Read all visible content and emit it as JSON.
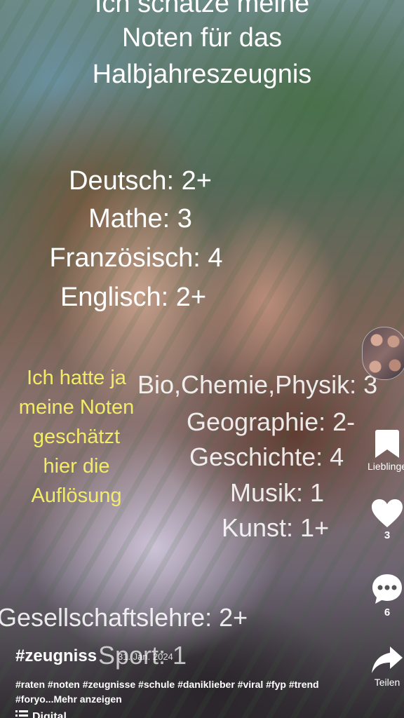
{
  "video": {
    "title_lines": [
      "Ich schätze meine",
      "Noten für das",
      "Halbjahreszeugnis"
    ],
    "grades_top": [
      "Deutsch: 2+",
      "Mathe: 3",
      "Französisch: 4",
      "Englisch: 2+"
    ],
    "grades_right": [
      "Bio,Chemie,Physik: 3",
      "Geographie: 2-",
      "Geschichte: 4",
      "Musik: 1",
      "Kunst: 1+"
    ],
    "grades_bottom": [
      "Gesellschaftslehre: 2+",
      "Sport: 1"
    ],
    "note_lines": [
      "Ich hatte ja",
      "meine Noten",
      "geschätzt",
      "hier die",
      "Auflösung"
    ],
    "note_color": "#f3ec6a"
  },
  "rail": {
    "favorite_label": "Lieblinge",
    "likes_count": "3",
    "comments_count": "6",
    "share_label": "Teilen"
  },
  "caption": {
    "user": "#zeugniss",
    "date": "31. Jan. 2024",
    "hashtags": "#raten #noten #zeugnisse #schule #daniklieber #viral #fyp #trend #foryo...",
    "more": "Mehr anzeigen"
  },
  "bottom": {
    "label": "Digital"
  }
}
